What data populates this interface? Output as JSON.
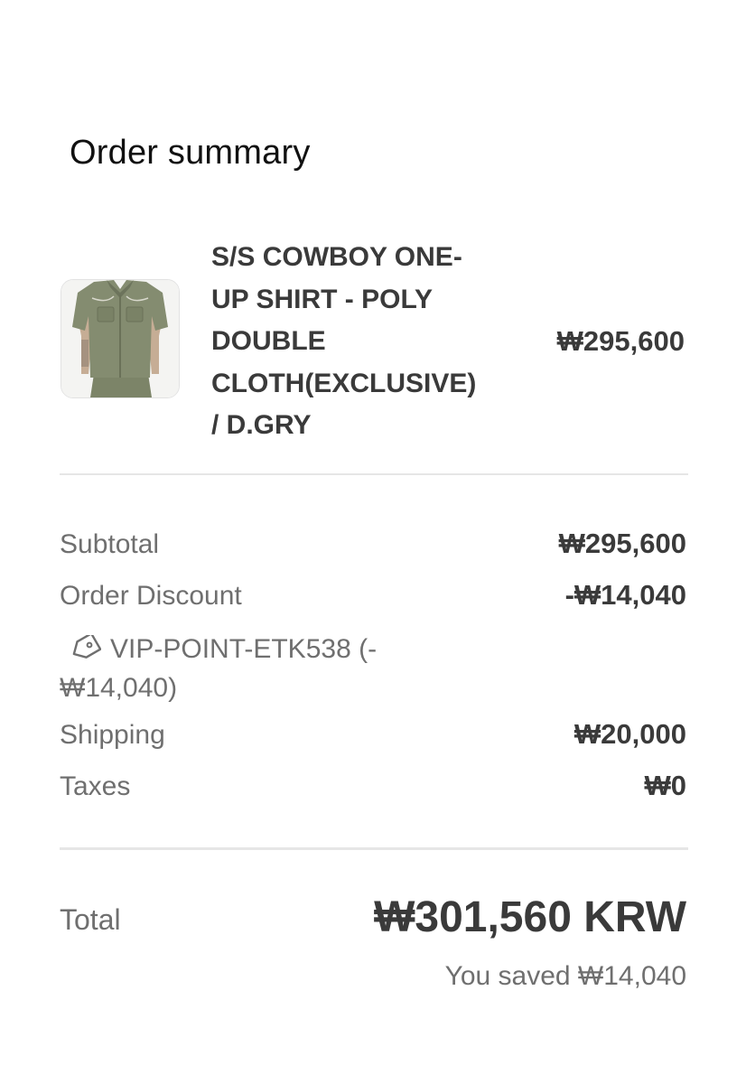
{
  "summary": {
    "title": "Order summary"
  },
  "product": {
    "image_icon": "shirt-product-image",
    "name_lines": [
      "S/S COWBOY ONE-",
      "UP SHIRT - POLY",
      "DOUBLE",
      "CLOTH(EXCLUSIVE)",
      "/ D.GRY"
    ],
    "price": "₩295,600"
  },
  "costs": {
    "subtotal_label": "Subtotal",
    "subtotal_value": "₩295,600",
    "discount_label": "Order Discount",
    "discount_value": "-₩14,040",
    "discount_code_icon": "tag-icon",
    "discount_code_line1": "VIP-POINT-ETK538 (-",
    "discount_code_line2": "₩14,040)",
    "shipping_label": "Shipping",
    "shipping_value": "₩20,000",
    "taxes_label": "Taxes",
    "taxes_value": "₩0"
  },
  "total": {
    "label": "Total",
    "value": "₩301,560 KRW",
    "savings": "You saved ₩14,040"
  },
  "colors": {
    "background": "#ffffff",
    "divider": "#e6e6e6",
    "primary_text": "#3a3a3a",
    "secondary_text": "#6f6f6f",
    "product_olive": "#848c70"
  }
}
